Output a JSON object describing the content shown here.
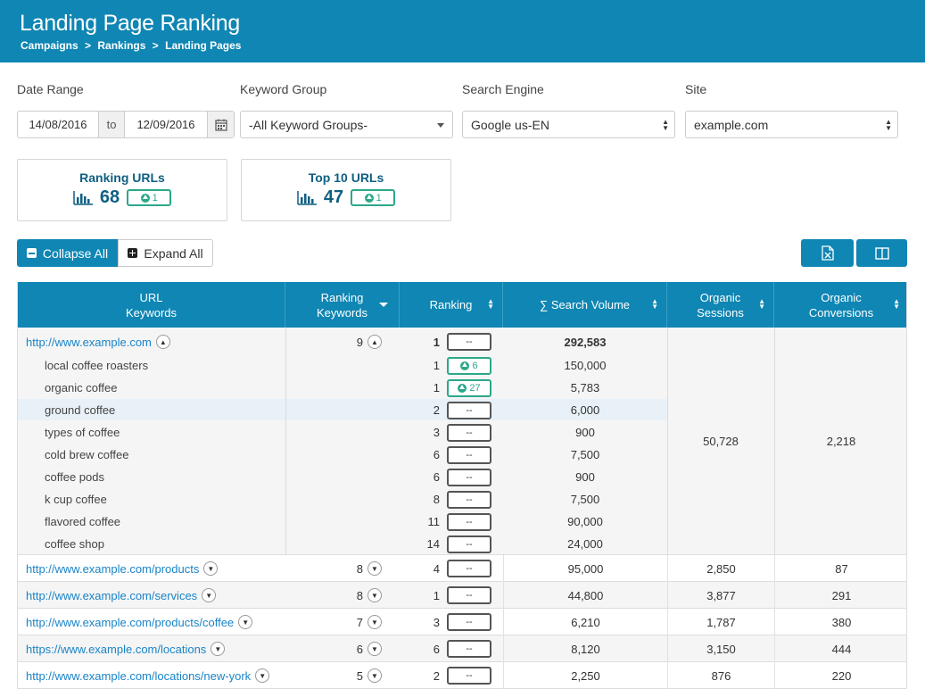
{
  "header": {
    "title": "Landing Page Ranking",
    "breadcrumb": [
      "Campaigns",
      "Rankings",
      "Landing Pages"
    ],
    "sep": ">"
  },
  "filters": {
    "date_range_label": "Date Range",
    "date_from": "14/08/2016",
    "date_to_label": "to",
    "date_to": "12/09/2016",
    "keyword_group_label": "Keyword Group",
    "keyword_group_value": "-All Keyword Groups-",
    "search_engine_label": "Search Engine",
    "search_engine_value": "Google us-EN",
    "site_label": "Site",
    "site_value": "example.com"
  },
  "cards": [
    {
      "title": "Ranking URLs",
      "value": "68",
      "change": "1"
    },
    {
      "title": "Top 10 URLs",
      "value": "47",
      "change": "1"
    }
  ],
  "buttons": {
    "collapse": "Collapse All",
    "expand": "Expand All"
  },
  "columns": [
    {
      "line1": "URL",
      "line2": "Keywords"
    },
    {
      "line1": "Ranking",
      "line2": "Keywords"
    },
    {
      "line1": "Ranking",
      "line2": ""
    },
    {
      "line1": "∑ Search Volume",
      "line2": ""
    },
    {
      "line1": "Organic",
      "line2": "Sessions"
    },
    {
      "line1": "Organic",
      "line2": "Conversions"
    }
  ],
  "expanded": {
    "url": "http://www.example.com",
    "ranking_keywords": "9",
    "ranking": "1",
    "ranking_change": "--",
    "search_volume": "292,583",
    "organic_sessions": "50,728",
    "organic_conversions": "2,218",
    "keywords": [
      {
        "name": "local coffee roasters",
        "rank": "1",
        "change": "6",
        "up": true,
        "volume": "150,000"
      },
      {
        "name": "organic coffee",
        "rank": "1",
        "change": "27",
        "up": true,
        "volume": "5,783"
      },
      {
        "name": "ground coffee",
        "rank": "2",
        "change": "--",
        "up": false,
        "volume": "6,000"
      },
      {
        "name": "types of coffee",
        "rank": "3",
        "change": "--",
        "up": false,
        "volume": "900"
      },
      {
        "name": "cold brew coffee",
        "rank": "6",
        "change": "--",
        "up": false,
        "volume": "7,500"
      },
      {
        "name": "coffee pods",
        "rank": "6",
        "change": "--",
        "up": false,
        "volume": "900"
      },
      {
        "name": "k cup coffee",
        "rank": "8",
        "change": "--",
        "up": false,
        "volume": "7,500"
      },
      {
        "name": "flavored coffee",
        "rank": "11",
        "change": "--",
        "up": false,
        "volume": "90,000"
      },
      {
        "name": "coffee shop",
        "rank": "14",
        "change": "--",
        "up": false,
        "volume": "24,000"
      }
    ]
  },
  "rows": [
    {
      "url": "http://www.example.com/products",
      "ranking_keywords": "8",
      "ranking": "4",
      "change": "--",
      "volume": "95,000",
      "sessions": "2,850",
      "conversions": "87"
    },
    {
      "url": "http://www.example.com/services",
      "ranking_keywords": "8",
      "ranking": "1",
      "change": "--",
      "volume": "44,800",
      "sessions": "3,877",
      "conversions": "291"
    },
    {
      "url": "http://www.example.com/products/coffee",
      "ranking_keywords": "7",
      "ranking": "3",
      "change": "--",
      "volume": "6,210",
      "sessions": "1,787",
      "conversions": "380"
    },
    {
      "url": "https://www.example.com/locations",
      "ranking_keywords": "6",
      "ranking": "6",
      "change": "--",
      "volume": "8,120",
      "sessions": "3,150",
      "conversions": "444"
    },
    {
      "url": "http://www.example.com/locations/new-york",
      "ranking_keywords": "5",
      "ranking": "2",
      "change": "--",
      "volume": "2,250",
      "sessions": "876",
      "conversions": "220"
    }
  ],
  "colors": {
    "primary": "#0f86b3",
    "up": "#2aa88a",
    "link": "#1a84c7"
  }
}
